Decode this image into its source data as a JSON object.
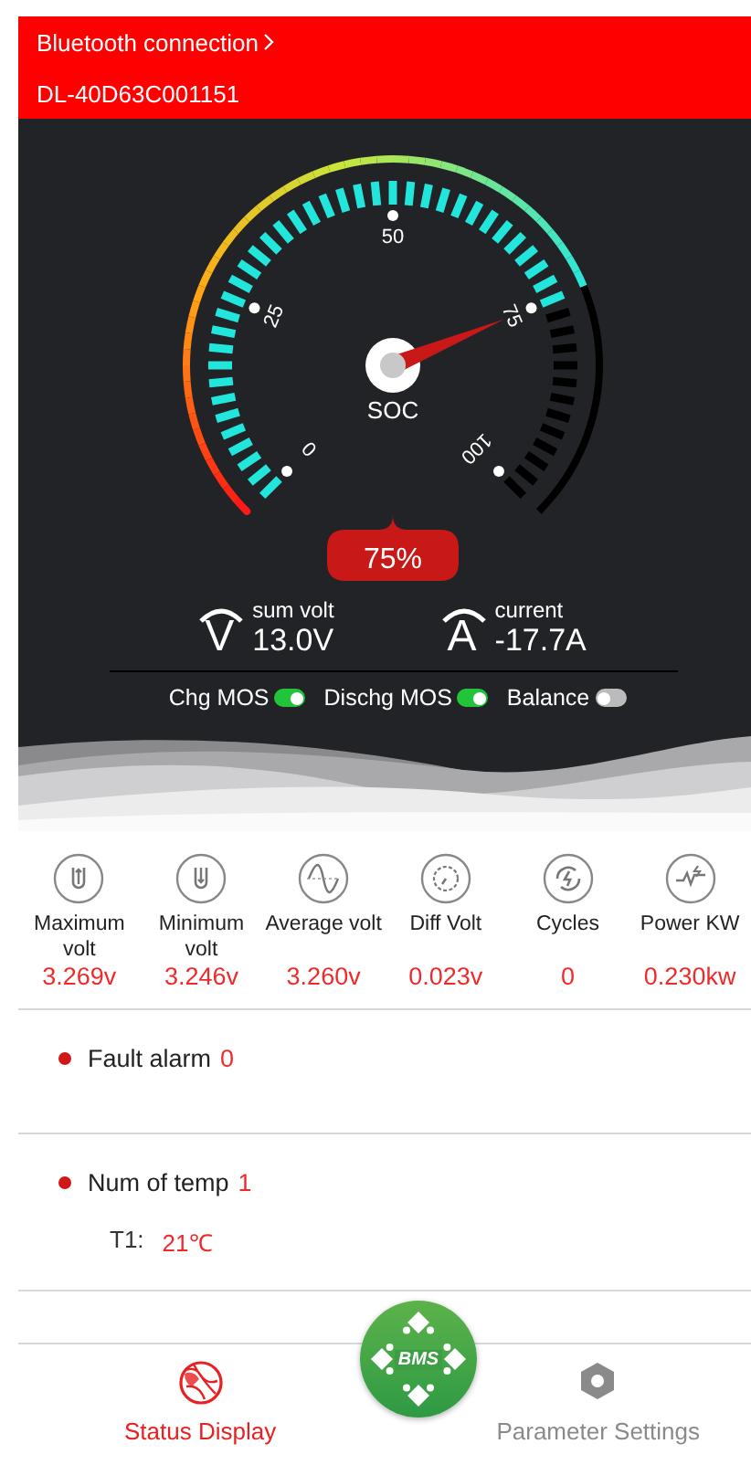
{
  "header": {
    "title": "Bluetooth connection",
    "device": "DL-40D63C001151"
  },
  "gauge": {
    "label": "SOC",
    "reading": "75%",
    "ticks": [
      "0",
      "25",
      "50",
      "75",
      "100"
    ]
  },
  "readings": [
    {
      "label": "sum volt",
      "value": "13.0V",
      "symbol": "V"
    },
    {
      "label": "current",
      "value": "-17.7A",
      "symbol": "A"
    }
  ],
  "switches": [
    {
      "label": "Chg MOS",
      "on": true
    },
    {
      "label": "Dischg MOS",
      "on": true
    },
    {
      "label": "Balance",
      "on": false
    }
  ],
  "stats": [
    {
      "kind": "max",
      "label": "Maximum volt",
      "value": "3.269v"
    },
    {
      "kind": "min",
      "label": "Minimum volt",
      "value": "3.246v"
    },
    {
      "kind": "avg",
      "label": "Average volt",
      "value": "3.260v"
    },
    {
      "kind": "diff",
      "label": "Diff Volt",
      "value": "0.023v"
    },
    {
      "kind": "cycles",
      "label": "Cycles",
      "value": "0"
    },
    {
      "kind": "power",
      "label": "Power KW",
      "value": "0.230kw"
    }
  ],
  "sections": [
    {
      "title": "Fault alarm",
      "value": "0"
    },
    {
      "title": "Num of temp",
      "value": "1",
      "details": [
        {
          "label": "T1:",
          "value": "21℃"
        }
      ]
    }
  ],
  "nav": {
    "logo": "BMS",
    "items": [
      {
        "kind": "status",
        "label": "Status Display",
        "selected": true
      },
      {
        "kind": "settings",
        "label": "Parameter Settings",
        "selected": false
      }
    ]
  }
}
